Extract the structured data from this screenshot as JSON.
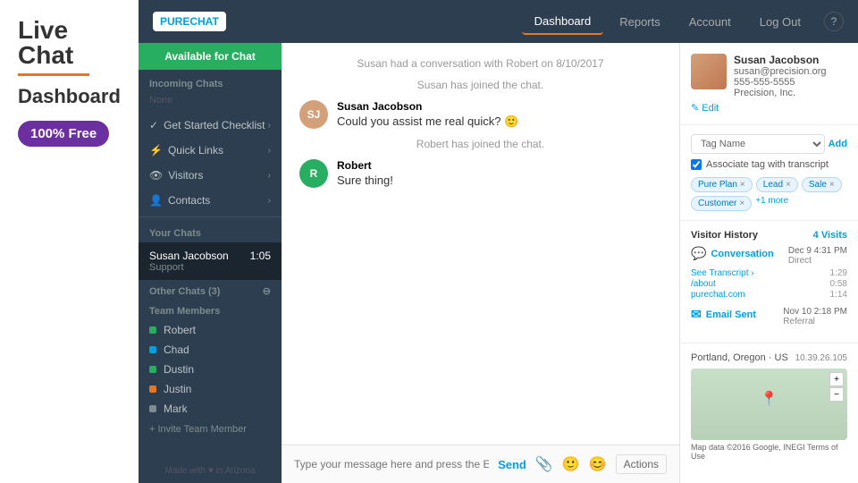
{
  "branding": {
    "live_chat": "Live Chat",
    "dashboard": "Dashboard",
    "free_badge": "100% Free"
  },
  "nav": {
    "logo_pure": "PURE",
    "logo_chat": "CHAT",
    "links": [
      {
        "label": "Dashboard",
        "active": true
      },
      {
        "label": "Reports",
        "active": false
      },
      {
        "label": "Account",
        "active": false
      },
      {
        "label": "Log Out",
        "active": false
      }
    ],
    "help": "?"
  },
  "sidebar": {
    "available_label": "Available for Chat",
    "incoming_label": "Incoming Chats",
    "incoming_none": "None",
    "menu_items": [
      {
        "icon": "✓",
        "label": "Get Started Checklist"
      },
      {
        "icon": "⚡",
        "label": "Quick Links"
      },
      {
        "icon": "👁",
        "label": "Visitors"
      },
      {
        "icon": "👤",
        "label": "Contacts"
      }
    ],
    "your_chats_label": "Your Chats",
    "active_chat": {
      "name": "Susan Jacobson",
      "sub": "Support",
      "time": "1:05"
    },
    "other_chats_label": "Other Chats (3)",
    "team_members_label": "Team Members",
    "team_members": [
      {
        "name": "Robert",
        "color": "#27ae60"
      },
      {
        "name": "Chad",
        "color": "#00a0e3"
      },
      {
        "name": "Dustin",
        "color": "#27ae60"
      },
      {
        "name": "Justin",
        "color": "#e87722"
      },
      {
        "name": "Mark",
        "color": "#7f8c8d"
      }
    ],
    "invite": "+ Invite Team Member",
    "footer": "Made with ♥ in Arizona"
  },
  "chat": {
    "system_msg1": "Susan had a conversation with Robert on 8/10/2017",
    "system_msg2": "Susan has joined the chat.",
    "messages": [
      {
        "sender": "Susan Jacobson",
        "text": "Could you assist me real quick? 🙂",
        "avatar_initials": "SJ",
        "avatar_color": "#d4a07a"
      }
    ],
    "system_msg3": "Robert has joined the chat.",
    "messages2": [
      {
        "sender": "Robert",
        "text": "Sure thing!",
        "avatar_initials": "R",
        "avatar_color": "#27ae60"
      }
    ],
    "input_placeholder": "Type your message here and press the Enter key to send.",
    "send_label": "Send",
    "actions_label": "Actions"
  },
  "contact": {
    "name": "Susan Jacobson",
    "email": "susan@precision.org",
    "phone": "555-555-5555",
    "company": "Precision, Inc.",
    "edit_label": "✎ Edit",
    "tag_placeholder": "Tag Name",
    "tag_add": "Add",
    "associate_label": "Associate tag with transcript",
    "tags": [
      {
        "label": "Pure Plan"
      },
      {
        "label": "Lead"
      },
      {
        "label": "Sale"
      },
      {
        "label": "Customer"
      }
    ],
    "more_tags": "+1 more"
  },
  "visitor_history": {
    "title": "Visitor History",
    "visits": "4 Visits",
    "items": [
      {
        "type": "Conversation",
        "date": "Dec 9 4:31 PM",
        "sub": "Direct",
        "links": [
          {
            "label": "See Transcript ›",
            "time": "1:29"
          },
          {
            "label": "/about",
            "time": "0:58"
          },
          {
            "label": "purechat.com",
            "time": "1:14"
          }
        ]
      },
      {
        "type": "Email Sent",
        "date": "Nov 10 2:18 PM",
        "sub": "Referral",
        "links": []
      }
    ]
  },
  "location": {
    "city": "Portland, Oregon · US",
    "ip": "10.39.26.105",
    "map_footer": "Map data ©2016 Google, INEGI   Terms of Use"
  }
}
